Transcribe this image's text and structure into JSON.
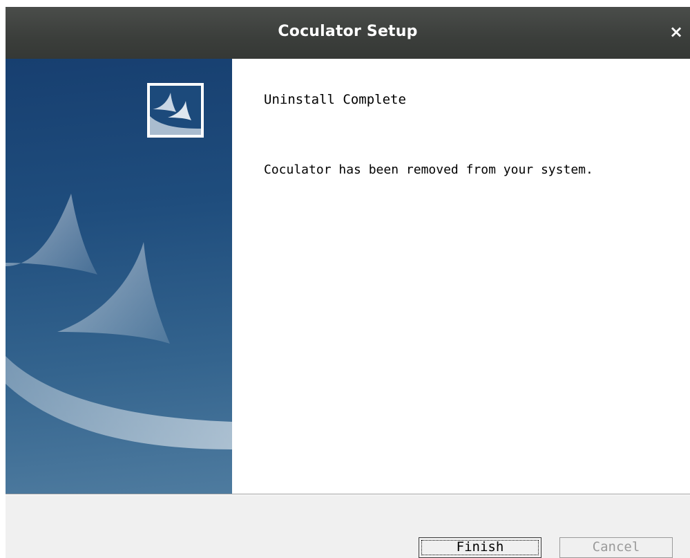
{
  "window": {
    "title": "Coculator Setup",
    "close_glyph": "×"
  },
  "content": {
    "heading": "Uninstall Complete",
    "message": "Coculator has been removed from your system."
  },
  "buttons": {
    "finish_label": "Finish",
    "cancel_label": "Cancel"
  },
  "icons": {
    "close": "close-icon",
    "logo": "installer-logo-icon"
  },
  "colors": {
    "titlebar": "#3b3e3b",
    "sidebar_top": "#173f70",
    "sidebar_bottom": "#4e7b9f",
    "disabled_text": "#9a9a9a"
  }
}
